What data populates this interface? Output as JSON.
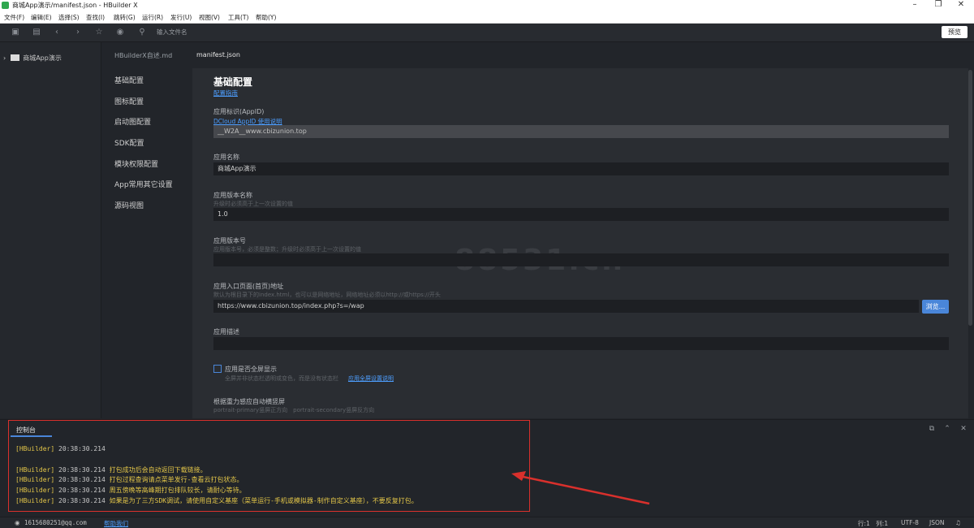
{
  "window": {
    "title": "商城App演示/manifest.json - HBuilder X"
  },
  "menu": [
    "文件(F)",
    "编辑(E)",
    "选择(S)",
    "查找(I)",
    "跳转(G)",
    "运行(R)",
    "发行(U)",
    "视图(V)",
    "工具(T)",
    "帮助(Y)"
  ],
  "toolbar": {
    "search_placeholder": "输入文件名",
    "preview_label": "预览"
  },
  "sidebar": {
    "project": "商城App演示"
  },
  "tabs": [
    {
      "label": "HBuilderX自述.md",
      "active": false
    },
    {
      "label": "manifest.json",
      "active": true
    }
  ],
  "config_nav": [
    "基础配置",
    "图标配置",
    "启动图配置",
    "SDK配置",
    "模块权限配置",
    "App常用其它设置",
    "源码视图"
  ],
  "form": {
    "section_title": "基础配置",
    "guide_link": "配置指南",
    "appid": {
      "label": "应用标识(AppID)",
      "link": "DCloud AppID 使用说明",
      "value": "__W2A__www.cbizunion.top"
    },
    "name": {
      "label": "应用名称",
      "value": "商城App演示"
    },
    "version_name": {
      "label": "应用版本名称",
      "hint": "升级时必须高于上一次设置的值",
      "value": "1.0"
    },
    "version_code": {
      "label": "应用版本号",
      "hint": "应用版本号，必须是整数；升级时必须高于上一次设置的值",
      "value": ""
    },
    "entry": {
      "label": "应用入口页面(首页)地址",
      "hint": "默认为根目录下的index.html，也可以是网络地址，网络地址必须以http://或https://开头",
      "value": "https://www.cbizunion.top/index.php?s=/wap",
      "browse": "浏览..."
    },
    "description": {
      "label": "应用描述",
      "value": ""
    },
    "fullscreen": {
      "label": "应用是否全屏显示",
      "hint": "全屏并非状态栏透明或变色，而是没有状态栏",
      "link": "应用全屏设置说明",
      "checked": false
    },
    "orientation": {
      "label": "根据重力感应自动横竖屏",
      "hint": "portrait-primary竖屏正方向　portrait-secondary竖屏反方向"
    }
  },
  "watermark": "88531.cn",
  "console": {
    "tab_label": "控制台",
    "lines": [
      {
        "tag": "[HBuilder]",
        "time": "20:38:30.214",
        "msg": ""
      },
      {
        "tag": "[HBuilder]",
        "time": "20:38:30.214",
        "msg": "打包成功后会自动返回下载链接。"
      },
      {
        "tag": "[HBuilder]",
        "time": "20:38:30.214",
        "msg": "打包过程查询请点菜单发行-查看云打包状态。"
      },
      {
        "tag": "[HBuilder]",
        "time": "20:38:30.214",
        "msg": "周五傍晚等高峰期打包排队较长，请耐心等待。"
      },
      {
        "tag": "[HBuilder]",
        "time": "20:38:30.214",
        "msg": "如果是为了三方SDK调试，请使用自定义基座（菜单运行-手机或模拟器-制作自定义基座），不要反复打包。"
      }
    ]
  },
  "status": {
    "user": "1615680251@qq.com",
    "help": "帮助我们",
    "position": "行:1　列:1",
    "encoding": "UTF-8",
    "language": "JSON"
  },
  "colors": {
    "accent": "#4a86d9",
    "console_text": "#e2c548",
    "highlight": "#d9302c"
  }
}
